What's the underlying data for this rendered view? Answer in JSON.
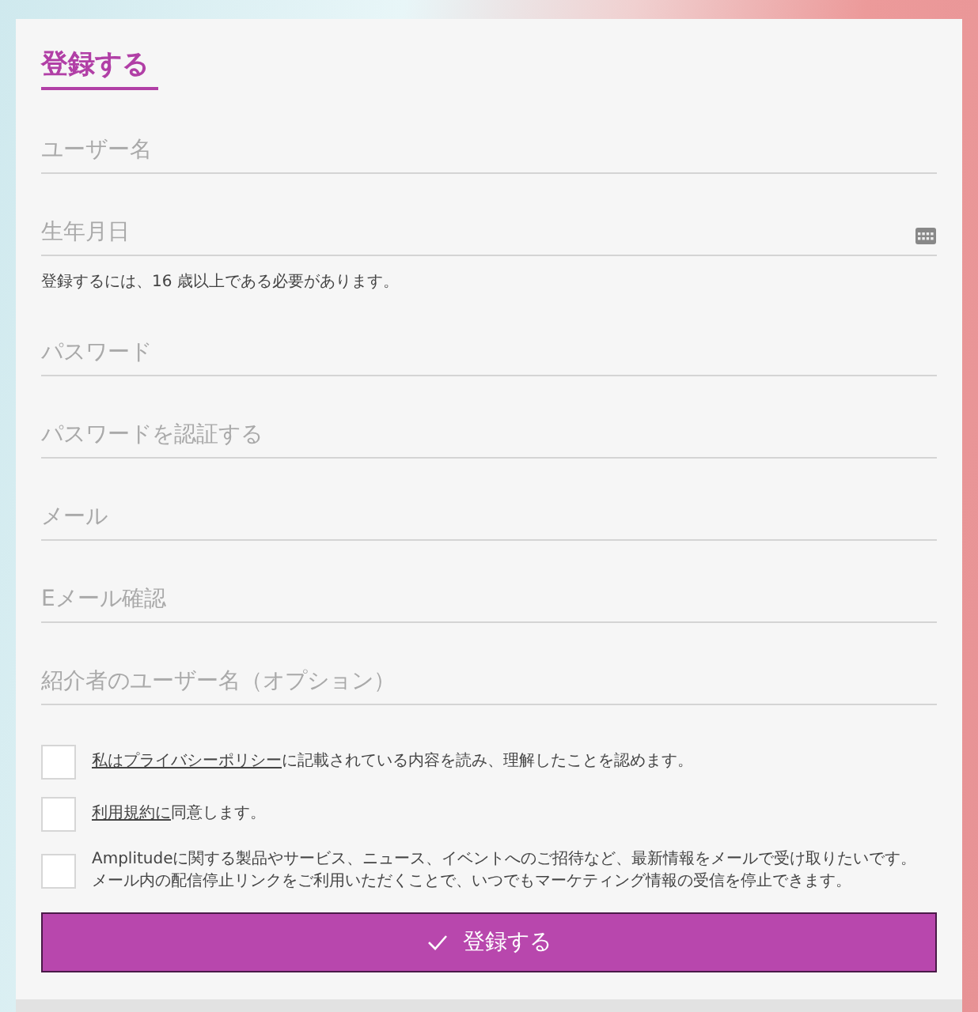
{
  "title": "登録する",
  "fields": [
    {
      "kind": "text",
      "placeholder": "ユーザー名"
    },
    {
      "kind": "date",
      "placeholder": "生年月日",
      "helper": "登録するには、16 歳以上である必要があります。"
    },
    {
      "kind": "password",
      "placeholder": "パスワード"
    },
    {
      "kind": "password",
      "placeholder": "パスワードを認証する"
    },
    {
      "kind": "text",
      "placeholder": "メール"
    },
    {
      "kind": "text",
      "placeholder": "Eメール確認"
    },
    {
      "kind": "text",
      "placeholder": "紹介者のユーザー名（オプション）"
    }
  ],
  "consents": [
    {
      "checked": false,
      "link": "私はプライバシーポリシー",
      "text": "に記載されている内容を読み、理解したことを認めます。"
    },
    {
      "checked": false,
      "link": "利用規約に",
      "text": "同意します。"
    },
    {
      "checked": false,
      "lines": [
        "Amplitudeに関する製品やサービス、ニュース、イベントへのご招待など、最新情報をメールで受け取りたいです。",
        "メール内の配信停止リンクをご利用いただくことで、いつでもマーケティング情報の受信を停止できます。"
      ]
    }
  ],
  "submit": {
    "label": "登録する"
  }
}
